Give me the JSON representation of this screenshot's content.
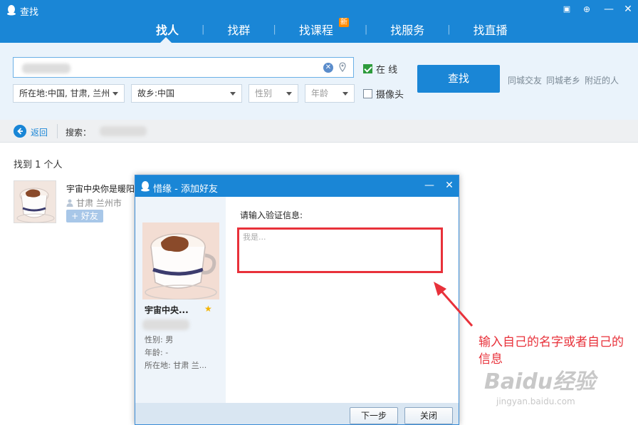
{
  "window": {
    "title": "查找"
  },
  "tabs": [
    {
      "label": "找人",
      "active": true
    },
    {
      "label": "找群"
    },
    {
      "label": "找课程",
      "badge": "新"
    },
    {
      "label": "找服务"
    },
    {
      "label": "找直播"
    }
  ],
  "search": {
    "location_label": "所在地:中国, 甘肃, 兰州",
    "hometown_label": "故乡:中国",
    "gender_placeholder": "性别",
    "age_placeholder": "年龄",
    "online_label": "在  线",
    "camera_label": "摄像头",
    "button_label": "查找",
    "quick_links": [
      "同城交友",
      "同城老乡",
      "附近的人"
    ]
  },
  "toolbar": {
    "back_label": "返回",
    "search_label": "搜索："
  },
  "results": {
    "found_text": "找到 1 个人",
    "item": {
      "name": "宇宙中央你是暖阳",
      "location": "甘肃 兰州市",
      "add_button": "+ 好友"
    }
  },
  "dialog": {
    "title": "惜缘 - 添加好友",
    "name": "宇宙中央...",
    "gender": "性别: 男",
    "age": "年龄: -",
    "location": "所在地: 甘肃 兰...",
    "verify_label": "请输入验证信息:",
    "verify_placeholder": "我是...",
    "next_button": "下一步",
    "close_button": "关闭"
  },
  "annotation": {
    "text": "输入自己的名字或者自己的信息"
  },
  "watermark": {
    "brand": "Baidu经验",
    "url": "jingyan.baidu.com"
  },
  "colors": {
    "accent": "#1a86d6",
    "highlight_red": "#e8313a"
  }
}
